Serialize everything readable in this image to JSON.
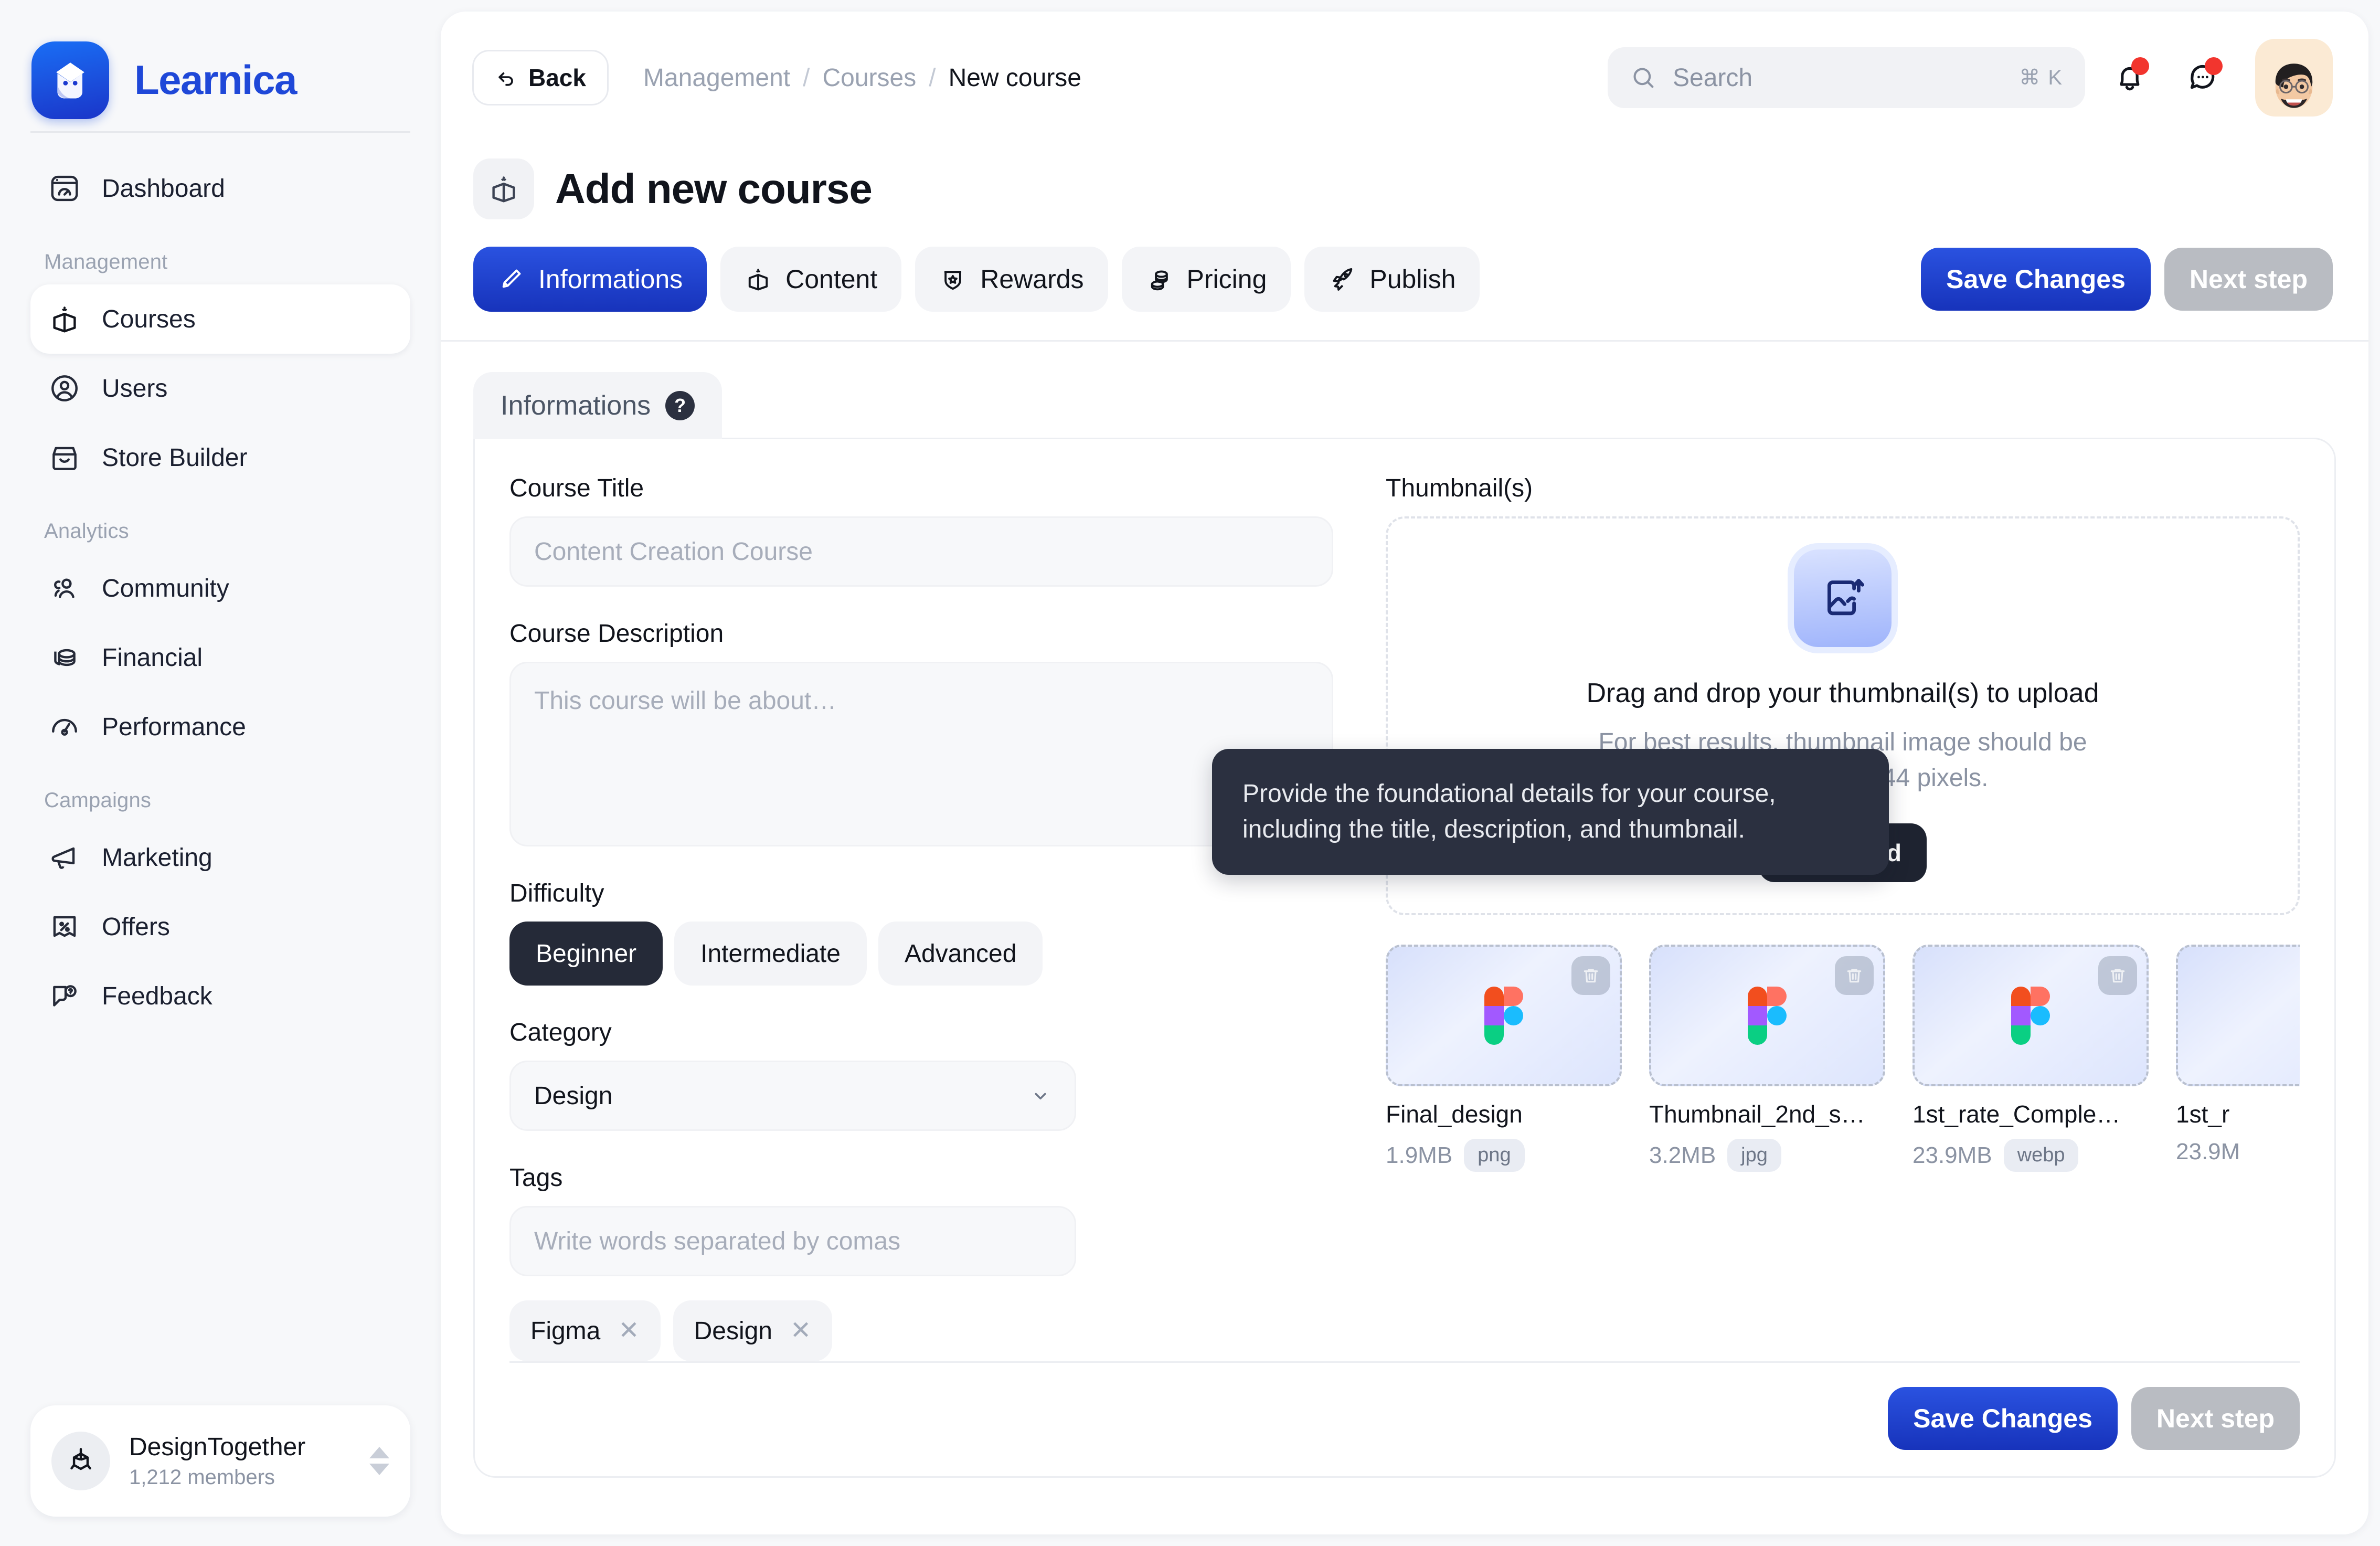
{
  "brand": {
    "name": "Learnica"
  },
  "sidebar": {
    "items": [
      {
        "label": "Dashboard",
        "icon": "dashboard-icon",
        "active": false
      },
      {
        "label": "Courses",
        "icon": "book-icon",
        "active": true
      },
      {
        "label": "Users",
        "icon": "user-circle-icon",
        "active": false
      },
      {
        "label": "Store Builder",
        "icon": "store-icon",
        "active": false
      },
      {
        "label": "Community",
        "icon": "users-group-icon",
        "active": false
      },
      {
        "label": "Financial",
        "icon": "coins-icon",
        "active": false
      },
      {
        "label": "Performance",
        "icon": "gauge-icon",
        "active": false
      },
      {
        "label": "Marketing",
        "icon": "megaphone-icon",
        "active": false
      },
      {
        "label": "Offers",
        "icon": "discount-icon",
        "active": false
      },
      {
        "label": "Feedback",
        "icon": "feedback-icon",
        "active": false
      }
    ],
    "groups": {
      "management": "Management",
      "analytics": "Analytics",
      "campaigns": "Campaigns"
    },
    "workspace": {
      "name": "DesignTogether",
      "members": "1,212 members"
    }
  },
  "topbar": {
    "back_label": "Back",
    "breadcrumb": {
      "first": "Management",
      "second": "Courses",
      "current": "New course",
      "separator": "/"
    },
    "search": {
      "placeholder": "Search",
      "shortcut": "⌘ K"
    }
  },
  "page": {
    "title": "Add new course"
  },
  "tabs": [
    {
      "label": "Informations",
      "icon": "pencil-icon",
      "active": true
    },
    {
      "label": "Content",
      "icon": "book-icon",
      "active": false
    },
    {
      "label": "Rewards",
      "icon": "badge-icon",
      "active": false
    },
    {
      "label": "Pricing",
      "icon": "coins-icon",
      "active": false
    },
    {
      "label": "Publish",
      "icon": "rocket-icon",
      "active": false
    }
  ],
  "actions": {
    "save_label": "Save Changes",
    "next_label": "Next step"
  },
  "card": {
    "tab_label": "Informations",
    "tooltip": "Provide the foundational details for your course, including the title, description, and thumbnail."
  },
  "form": {
    "title_label": "Course Title",
    "title_placeholder": "Content Creation Course",
    "description_label": "Course Description",
    "description_placeholder": "This course will be about…",
    "difficulty_label": "Difficulty",
    "difficulty_options": [
      {
        "label": "Beginner",
        "selected": true
      },
      {
        "label": "Intermediate",
        "selected": false
      },
      {
        "label": "Advanced",
        "selected": false
      }
    ],
    "category_label": "Category",
    "category_value": "Design",
    "tags_label": "Tags",
    "tags_placeholder": "Write words separated by comas",
    "tags": [
      {
        "label": "Figma"
      },
      {
        "label": "Design"
      }
    ]
  },
  "thumbnails": {
    "label": "Thumbnail(s)",
    "dropzone_title": "Drag and drop your thumbnail(s) to upload",
    "dropzone_sub_line1": "For best results, thumbnail image should be",
    "dropzone_sub_line2": "at least 1530 x 944 pixels.",
    "upload_label": "Upload",
    "files": [
      {
        "name": "Final_design",
        "size": "1.9MB",
        "ext": "png"
      },
      {
        "name": "Thumbnail_2nd_s…",
        "size": "3.2MB",
        "ext": "jpg"
      },
      {
        "name": "1st_rate_Comple…",
        "size": "23.9MB",
        "ext": "webp"
      },
      {
        "name": "1st_r",
        "size": "23.9M",
        "ext": ""
      }
    ]
  },
  "colors": {
    "accent": "#1f48d8",
    "accent_dark": "#1733bb",
    "dark": "#252a38",
    "muted": "#b9bcc2",
    "notification": "#f2352e"
  }
}
